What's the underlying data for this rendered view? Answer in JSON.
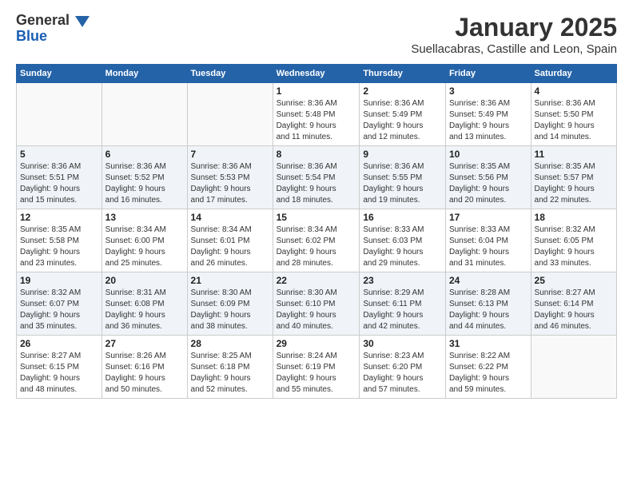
{
  "logo": {
    "general": "General",
    "blue": "Blue"
  },
  "header": {
    "month": "January 2025",
    "location": "Suellacabras, Castille and Leon, Spain"
  },
  "weekdays": [
    "Sunday",
    "Monday",
    "Tuesday",
    "Wednesday",
    "Thursday",
    "Friday",
    "Saturday"
  ],
  "weeks": [
    [
      {
        "day": "",
        "info": ""
      },
      {
        "day": "",
        "info": ""
      },
      {
        "day": "",
        "info": ""
      },
      {
        "day": "1",
        "info": "Sunrise: 8:36 AM\nSunset: 5:48 PM\nDaylight: 9 hours\nand 11 minutes."
      },
      {
        "day": "2",
        "info": "Sunrise: 8:36 AM\nSunset: 5:49 PM\nDaylight: 9 hours\nand 12 minutes."
      },
      {
        "day": "3",
        "info": "Sunrise: 8:36 AM\nSunset: 5:49 PM\nDaylight: 9 hours\nand 13 minutes."
      },
      {
        "day": "4",
        "info": "Sunrise: 8:36 AM\nSunset: 5:50 PM\nDaylight: 9 hours\nand 14 minutes."
      }
    ],
    [
      {
        "day": "5",
        "info": "Sunrise: 8:36 AM\nSunset: 5:51 PM\nDaylight: 9 hours\nand 15 minutes."
      },
      {
        "day": "6",
        "info": "Sunrise: 8:36 AM\nSunset: 5:52 PM\nDaylight: 9 hours\nand 16 minutes."
      },
      {
        "day": "7",
        "info": "Sunrise: 8:36 AM\nSunset: 5:53 PM\nDaylight: 9 hours\nand 17 minutes."
      },
      {
        "day": "8",
        "info": "Sunrise: 8:36 AM\nSunset: 5:54 PM\nDaylight: 9 hours\nand 18 minutes."
      },
      {
        "day": "9",
        "info": "Sunrise: 8:36 AM\nSunset: 5:55 PM\nDaylight: 9 hours\nand 19 minutes."
      },
      {
        "day": "10",
        "info": "Sunrise: 8:35 AM\nSunset: 5:56 PM\nDaylight: 9 hours\nand 20 minutes."
      },
      {
        "day": "11",
        "info": "Sunrise: 8:35 AM\nSunset: 5:57 PM\nDaylight: 9 hours\nand 22 minutes."
      }
    ],
    [
      {
        "day": "12",
        "info": "Sunrise: 8:35 AM\nSunset: 5:58 PM\nDaylight: 9 hours\nand 23 minutes."
      },
      {
        "day": "13",
        "info": "Sunrise: 8:34 AM\nSunset: 6:00 PM\nDaylight: 9 hours\nand 25 minutes."
      },
      {
        "day": "14",
        "info": "Sunrise: 8:34 AM\nSunset: 6:01 PM\nDaylight: 9 hours\nand 26 minutes."
      },
      {
        "day": "15",
        "info": "Sunrise: 8:34 AM\nSunset: 6:02 PM\nDaylight: 9 hours\nand 28 minutes."
      },
      {
        "day": "16",
        "info": "Sunrise: 8:33 AM\nSunset: 6:03 PM\nDaylight: 9 hours\nand 29 minutes."
      },
      {
        "day": "17",
        "info": "Sunrise: 8:33 AM\nSunset: 6:04 PM\nDaylight: 9 hours\nand 31 minutes."
      },
      {
        "day": "18",
        "info": "Sunrise: 8:32 AM\nSunset: 6:05 PM\nDaylight: 9 hours\nand 33 minutes."
      }
    ],
    [
      {
        "day": "19",
        "info": "Sunrise: 8:32 AM\nSunset: 6:07 PM\nDaylight: 9 hours\nand 35 minutes."
      },
      {
        "day": "20",
        "info": "Sunrise: 8:31 AM\nSunset: 6:08 PM\nDaylight: 9 hours\nand 36 minutes."
      },
      {
        "day": "21",
        "info": "Sunrise: 8:30 AM\nSunset: 6:09 PM\nDaylight: 9 hours\nand 38 minutes."
      },
      {
        "day": "22",
        "info": "Sunrise: 8:30 AM\nSunset: 6:10 PM\nDaylight: 9 hours\nand 40 minutes."
      },
      {
        "day": "23",
        "info": "Sunrise: 8:29 AM\nSunset: 6:11 PM\nDaylight: 9 hours\nand 42 minutes."
      },
      {
        "day": "24",
        "info": "Sunrise: 8:28 AM\nSunset: 6:13 PM\nDaylight: 9 hours\nand 44 minutes."
      },
      {
        "day": "25",
        "info": "Sunrise: 8:27 AM\nSunset: 6:14 PM\nDaylight: 9 hours\nand 46 minutes."
      }
    ],
    [
      {
        "day": "26",
        "info": "Sunrise: 8:27 AM\nSunset: 6:15 PM\nDaylight: 9 hours\nand 48 minutes."
      },
      {
        "day": "27",
        "info": "Sunrise: 8:26 AM\nSunset: 6:16 PM\nDaylight: 9 hours\nand 50 minutes."
      },
      {
        "day": "28",
        "info": "Sunrise: 8:25 AM\nSunset: 6:18 PM\nDaylight: 9 hours\nand 52 minutes."
      },
      {
        "day": "29",
        "info": "Sunrise: 8:24 AM\nSunset: 6:19 PM\nDaylight: 9 hours\nand 55 minutes."
      },
      {
        "day": "30",
        "info": "Sunrise: 8:23 AM\nSunset: 6:20 PM\nDaylight: 9 hours\nand 57 minutes."
      },
      {
        "day": "31",
        "info": "Sunrise: 8:22 AM\nSunset: 6:22 PM\nDaylight: 9 hours\nand 59 minutes."
      },
      {
        "day": "",
        "info": ""
      }
    ]
  ]
}
